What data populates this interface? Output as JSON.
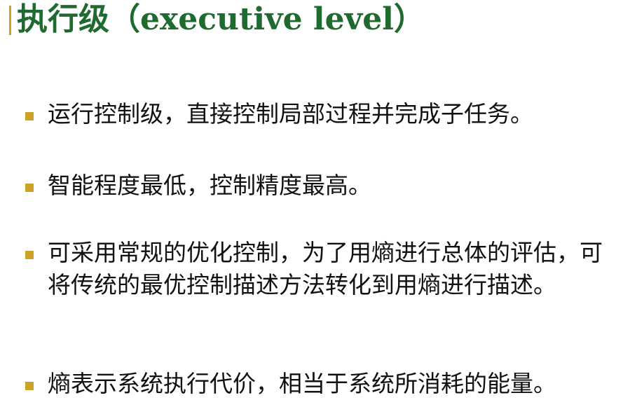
{
  "title": "执行级（executive level）",
  "accent_color": "#c9a227",
  "title_color": "#1f6b2f",
  "bullets": [
    "运行控制级，直接控制局部过程并完成子任务。",
    "智能程度最低，控制精度最高。",
    "可采用常规的优化控制，为了用熵进行总体的评估，可将传统的最优控制描述方法转化到用熵进行描述。",
    "熵表示系统执行代价，相当于系统所消耗的能量。"
  ]
}
